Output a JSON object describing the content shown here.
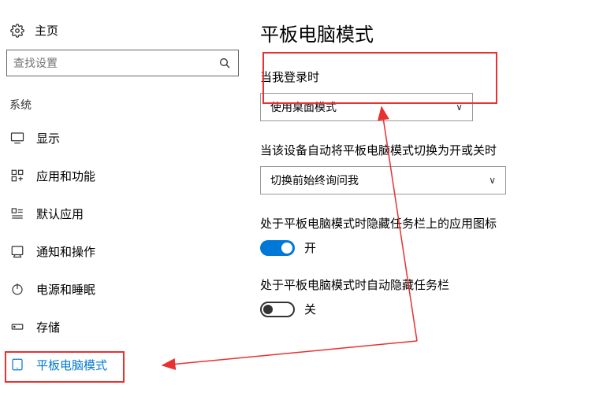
{
  "sidebar": {
    "home_label": "主页",
    "search_placeholder": "查找设置",
    "section_label": "系统",
    "items": [
      {
        "label": "显示"
      },
      {
        "label": "应用和功能"
      },
      {
        "label": "默认应用"
      },
      {
        "label": "通知和操作"
      },
      {
        "label": "电源和睡眠"
      },
      {
        "label": "存储"
      },
      {
        "label": "平板电脑模式"
      }
    ]
  },
  "main": {
    "title": "平板电脑模式",
    "login_label": "当我登录时",
    "login_dropdown_value": "使用桌面模式",
    "switch_label": "当该设备自动将平板电脑模式切换为开或关时",
    "switch_dropdown_value": "切换前始终询问我",
    "hide_icons_label": "处于平板电脑模式时隐藏任务栏上的应用图标",
    "hide_icons_toggle_text": "开",
    "hide_taskbar_label": "处于平板电脑模式时自动隐藏任务栏",
    "hide_taskbar_toggle_text": "关"
  }
}
